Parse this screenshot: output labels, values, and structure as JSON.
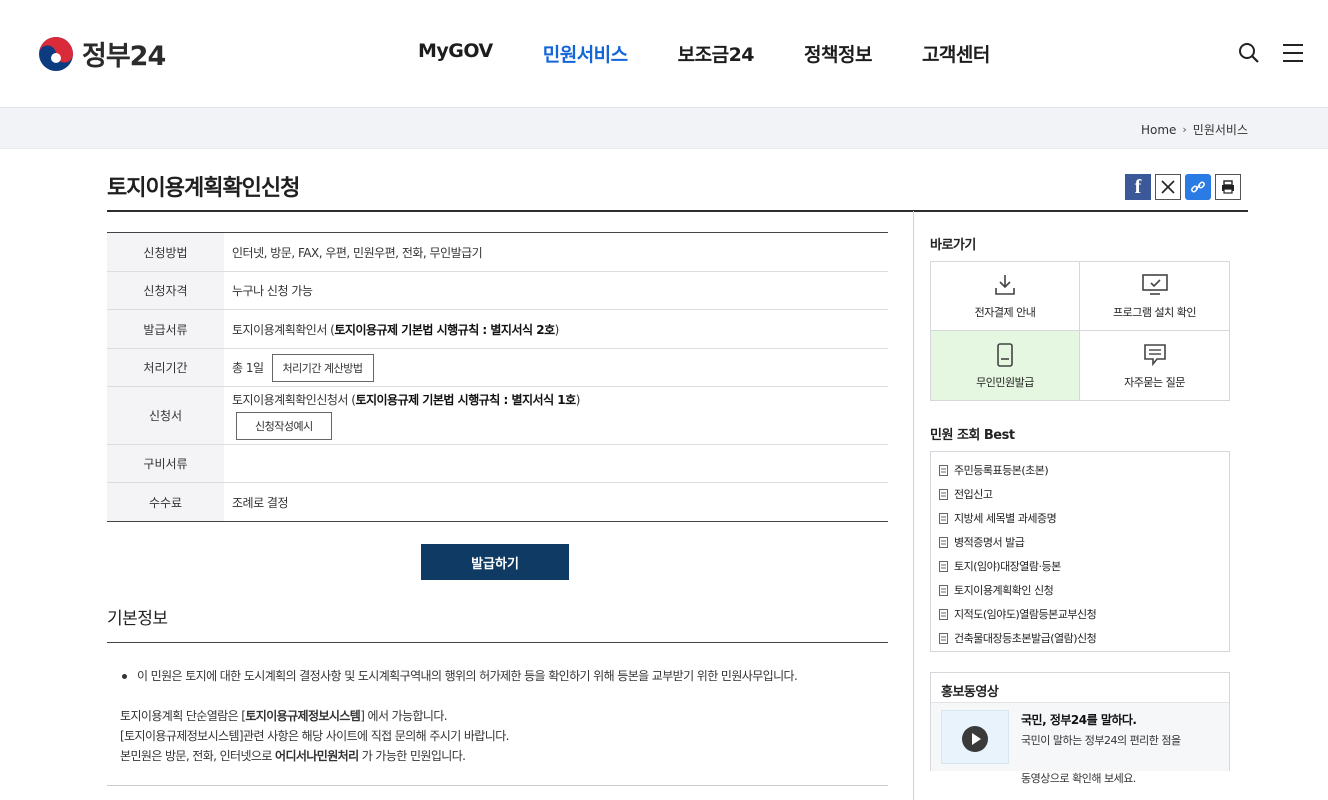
{
  "header": {
    "logo_text": "정부24",
    "nav": [
      "MyGOV",
      "민원서비스",
      "보조금24",
      "정책정보",
      "고객센터"
    ],
    "active_nav": 1
  },
  "breadcrumb": {
    "home": "Home",
    "current": "민원서비스"
  },
  "page": {
    "title": "토지이용계획확인신청"
  },
  "info": {
    "method_label": "신청방법",
    "method_value": "인터넷, 방문, FAX, 우편, 민원우편, 전화, 무인발급기",
    "eligibility_label": "신청자격",
    "eligibility_value": "누구나 신청 가능",
    "doc_label": "발급서류",
    "doc_value": "토지이용계획확인서 (",
    "doc_bold": "토지이용규제 기본법 시행규칙 : 별지서식 2호",
    "doc_end": ")",
    "period_label": "처리기간",
    "period_value": "총 1일",
    "period_button": "처리기간 계산방법",
    "form_label": "신청서",
    "form_value": "토지이용계획확인신청서 (",
    "form_bold": "토지이용규제 기본법 시행규칙 : 별지서식 1호",
    "form_end": ")",
    "form_button": "신청작성예시",
    "required_label": "구비서류",
    "required_value": "",
    "fee_label": "수수료",
    "fee_value": "조례로 결정"
  },
  "issue_button": "발급하기",
  "basic": {
    "title": "기본정보",
    "bullet": "이 민원은 토지에 대한 도시계획의 결정사항 및 도시계획구역내의 행위의 허가제한 등을 확인하기 위해 등본을 교부받기 위한 민원사무입니다.",
    "p1_pre": "토지이용계획 단순열람은 [",
    "p1_bold": "토지이용규제정보시스템",
    "p1_post": "] 에서 가능합니다.",
    "p2": "[토지이용규제정보시스템]관련 사항은 해당 사이트에 직접 문의해 주시기 바랍니다.",
    "p3_pre": "본민원은 방문, 전화, 인터넷으로 ",
    "p3_bold": "어디서나민원처리",
    "p3_post": " 가 가능한 민원입니다."
  },
  "sidebar": {
    "quick_title": "바로가기",
    "quick": [
      "전자결제 안내",
      "프로그램 설치 확인",
      "무인민원발급",
      "자주묻는 질문"
    ],
    "best_title": "민원 조회 Best",
    "best": [
      "주민등록표등본(초본)",
      "전입신고",
      "지방세 세목별 과세증명",
      "병적증명서 발급",
      "토지(임야)대장열람·등본",
      "토지이용계획확인 신청",
      "지적도(임야도)열람등본교부신청",
      "건축물대장등초본발급(열람)신청"
    ],
    "promo_title": "홍보동영상",
    "promo_headline": "국민, 정부24를 말하다.",
    "promo_desc1": "국민이 말하는 정부24의 편리한 점을",
    "promo_desc2": "동영상으로 확인해 보세요."
  }
}
